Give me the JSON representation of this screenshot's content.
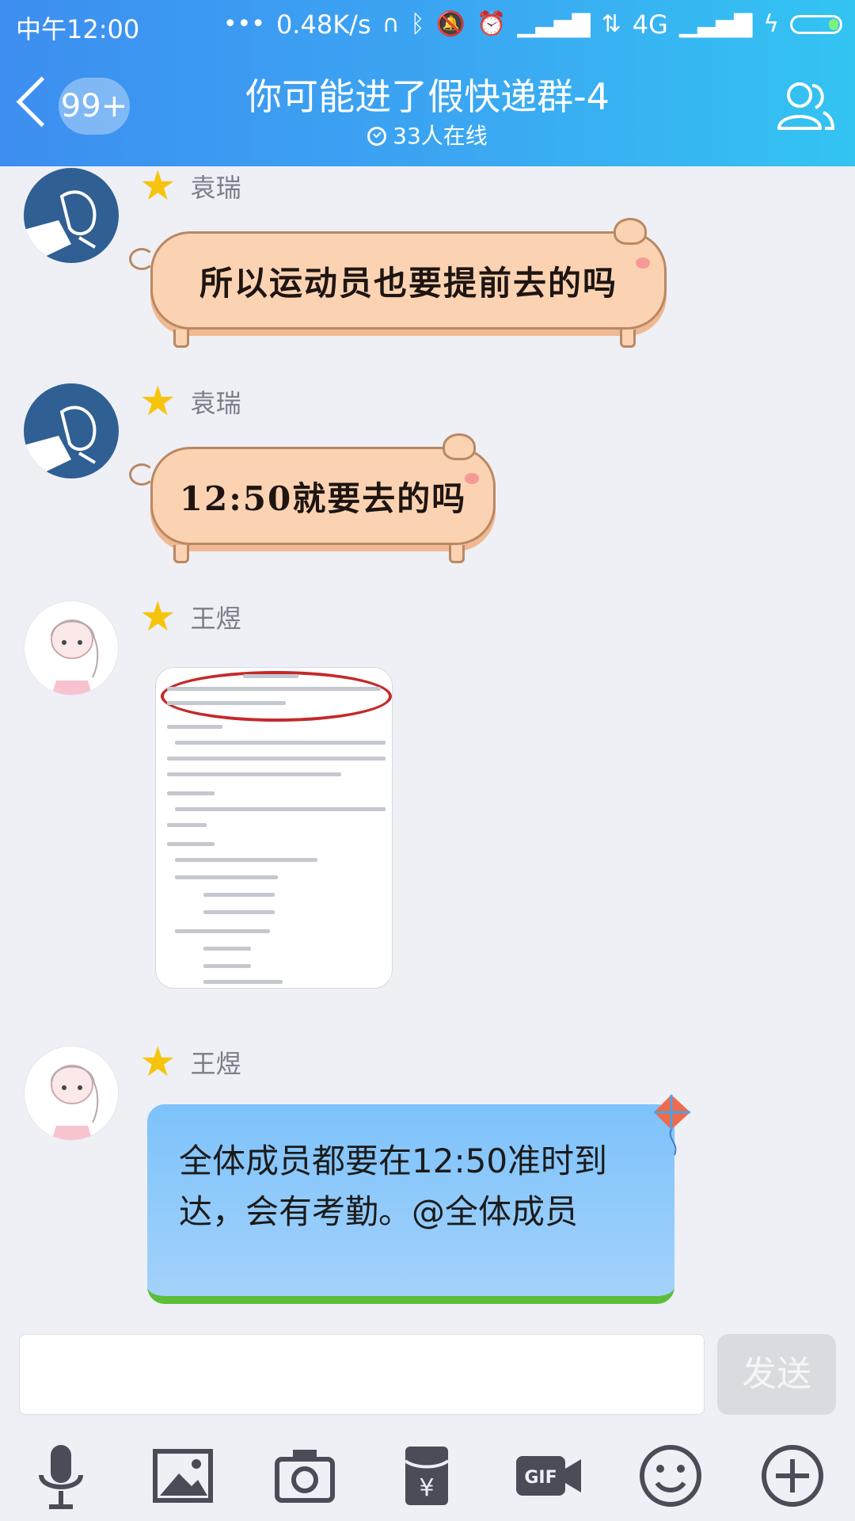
{
  "status_bar": {
    "time": "中午12:00",
    "network_speed": "0.48K/s",
    "network_type": "4G"
  },
  "header": {
    "unread_count": "99+",
    "title": "你可能进了假快递群-4",
    "online": "33人在线"
  },
  "messages": [
    {
      "sender": "袁瑞",
      "avatar": "fish-avatar",
      "text": "所以运动员也要提前去的吗",
      "bubble": "pig"
    },
    {
      "sender": "袁瑞",
      "avatar": "fish-avatar",
      "text": "12:50就要去的吗",
      "bubble": "pig"
    },
    {
      "sender": "王煜",
      "avatar": "girl-avatar",
      "type": "image"
    },
    {
      "sender": "王煜",
      "avatar": "girl-avatar",
      "text": "全体成员都要在12:50准时到达，会有考勤。@全体成员",
      "bubble": "blue"
    }
  ],
  "input": {
    "value": "",
    "placeholder": "",
    "send_label": "发送"
  },
  "toolbar": [
    "microphone-icon",
    "image-icon",
    "camera-icon",
    "red-packet-icon",
    "gif-icon",
    "emoji-icon",
    "plus-icon"
  ],
  "colors": {
    "header_gradient_start": "#3d8ef0",
    "header_gradient_end": "#33c4f2",
    "pig_bubble": "#fbd3b2",
    "blue_bubble": "#a3d2fb",
    "background": "#eef0f6"
  }
}
